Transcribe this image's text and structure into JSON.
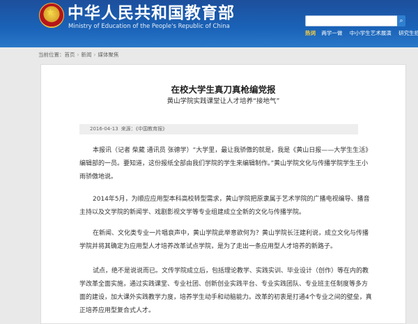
{
  "header": {
    "site_title": "中华人民共和国教育部",
    "site_subtitle": "Ministry of Education of the People's Republic of China",
    "search": {
      "placeholder": "",
      "button_icon": "search-icon"
    },
    "hot": {
      "label": "热词",
      "links": [
        "两学一做",
        "中小学生艺术展演",
        "研究生招"
      ]
    },
    "colors": {
      "brand": "#1a5fb4",
      "hot": "#ffd23c"
    }
  },
  "breadcrumb": {
    "prefix": "当前位置：",
    "items": [
      "首页",
      "新闻",
      "媒体聚焦"
    ]
  },
  "article": {
    "title": "在校大学生真刀真枪编党报",
    "subtitle": "黄山学院实践课堂让人才培养“接地气”",
    "date": "2016-04-13",
    "source": "来源：《中国教育报》",
    "paragraphs": [
      "本报讯（记者 柴葳 通讯员 张德学）“大学里，最让我骄傲的就是，我是《黄山日报——大学生生活》编辑部的一员。要知道，这份报纸全部由我们学院的学生来编辑制作。”黄山学院文化与传播学院学生王小雨骄傲地说。",
      "2014年5月，为顺应应用型本科高校转型需求，黄山学院把原隶属于艺术学院的广播电视编导、播音主持以及文学院的新闻学、戏剧影视文学等专业组建成立全新的文化与传播学院。",
      "在新闻、文化类专业一片唱衰声中，黄山学院此举意欲何为？黄山学院长汪建利说，成立文化与传播学院并将其确定为应用型人才培养改革试点学院，是为了走出一条应用型人才培养的新路子。",
      "试点，绝不是说说而已。文传学院成立后，包括理论教学、实践实训、毕业设计（创作）等在内的教学改革全面实施，通过实践课堂、专业社团、创新创业实践平台、专业实践团队、专业班主任制度等多方面的建设，加大课外实践教学力度，培养学生动手和动脑能力。改革的初衷是打通4个专业之间的壁垒，真正培养应用型复合式人才。"
    ]
  }
}
